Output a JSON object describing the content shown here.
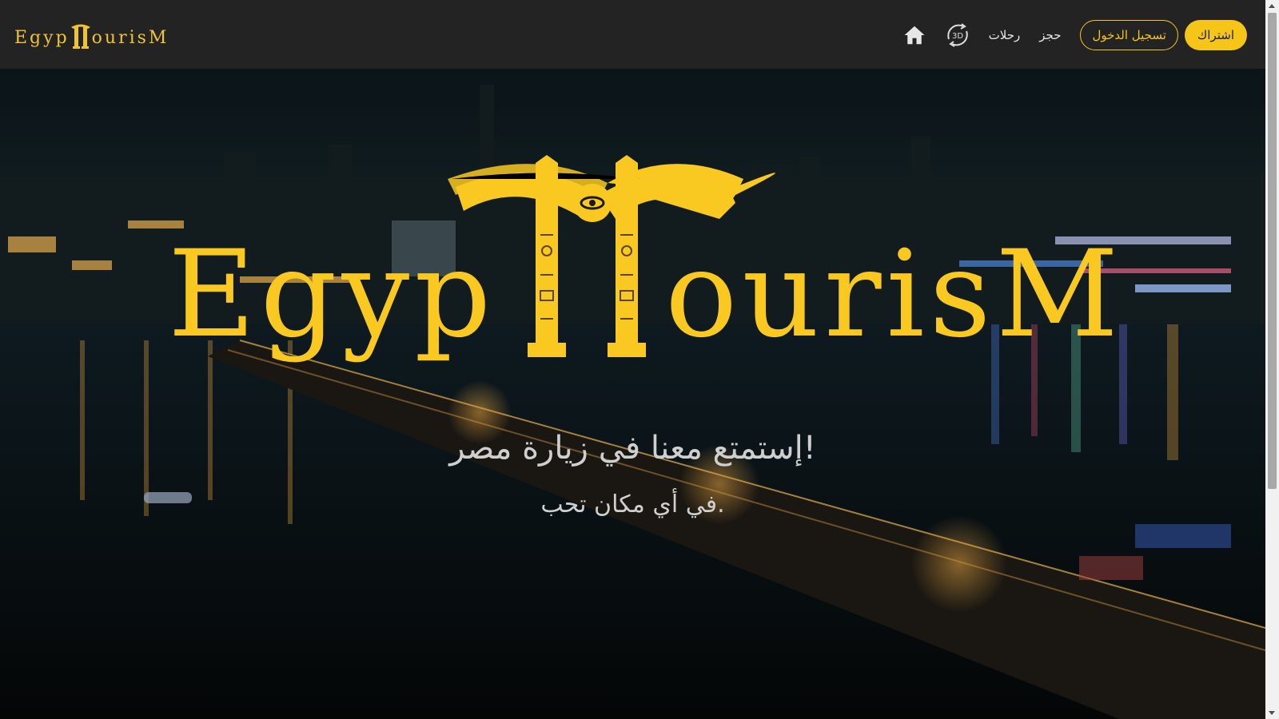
{
  "navbar": {
    "brand": {
      "prefix": "Egyp",
      "suffix": "ourisM"
    },
    "links": {
      "bookings": "حجز",
      "trips": "رحلات"
    },
    "icons": {
      "home": "home-icon",
      "tour_3d": "3d-rotate-icon",
      "tour_3d_text": "3D"
    },
    "login_label": "تسجيل الدخول",
    "signup_label": "اشتراك",
    "accent_color": "#f5c518",
    "background_color": "#232323"
  },
  "hero": {
    "logo": {
      "prefix": "Egyp",
      "suffix": "ourisM"
    },
    "title": "إستمتع معنا في زيارة مصر!",
    "subtitle": "في أي مكان تحب.",
    "background": "cairo-night-skyline-nile-bridge"
  }
}
